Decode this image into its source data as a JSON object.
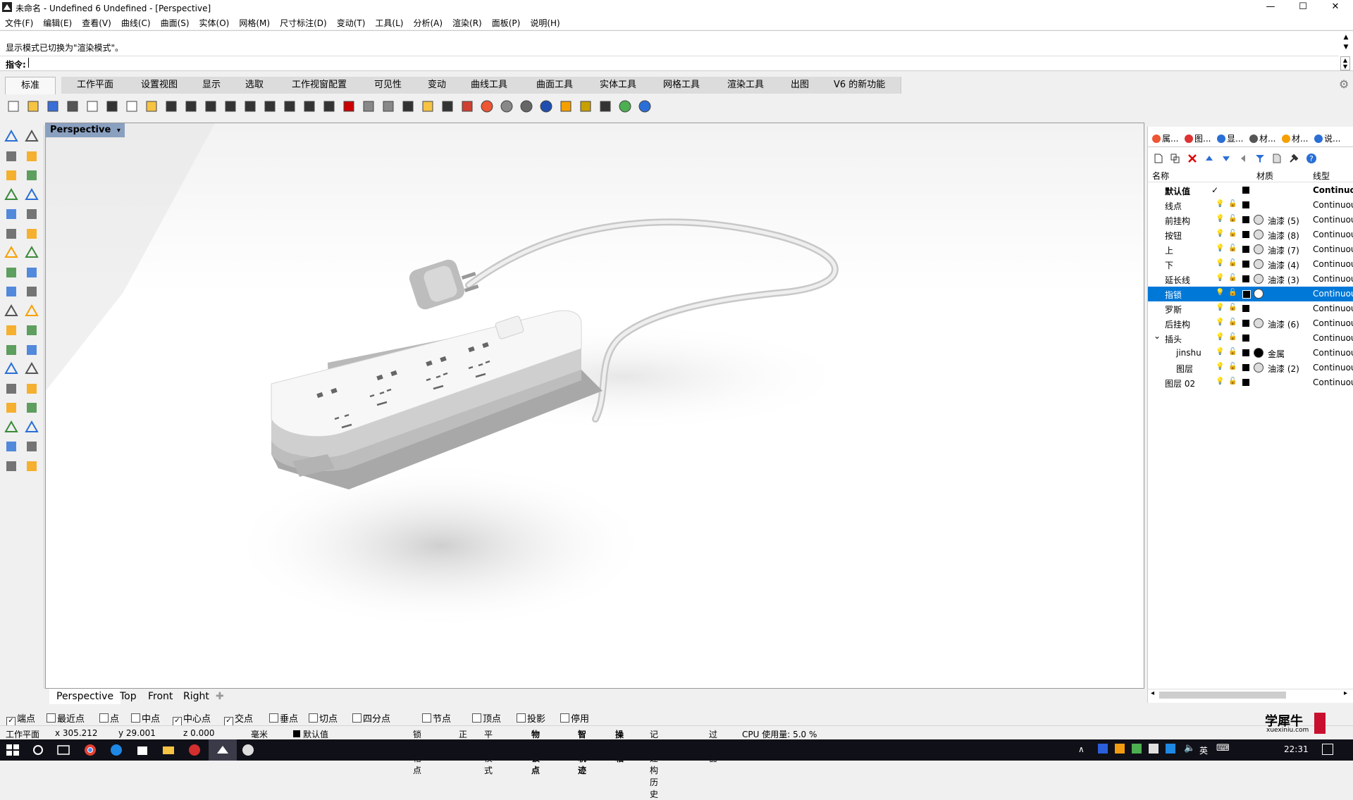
{
  "titlebar": {
    "title": "未命名 - Undefined 6 Undefined - [Perspective]",
    "minimize": "—",
    "maximize": "☐",
    "close": "✕"
  },
  "menu": [
    "文件(F)",
    "编辑(E)",
    "查看(V)",
    "曲线(C)",
    "曲面(S)",
    "实体(O)",
    "网格(M)",
    "尺寸标注(D)",
    "变动(T)",
    "工具(L)",
    "分析(A)",
    "渲染(R)",
    "面板(P)",
    "说明(H)"
  ],
  "command": {
    "history": "显示模式已切换为\"渲染模式\"。",
    "prompt": "指令:",
    "value": ""
  },
  "tabs": [
    "标准",
    "工作平面",
    "设置视图",
    "显示",
    "选取",
    "工作视窗配置",
    "可见性",
    "变动",
    "曲线工具",
    "曲面工具",
    "实体工具",
    "网格工具",
    "渲染工具",
    "出图",
    "V6 的新功能"
  ],
  "viewport": {
    "label": "Perspective"
  },
  "viewport_tabs": [
    "Perspective",
    "Top",
    "Front",
    "Right"
  ],
  "snaps": [
    {
      "label": "端点",
      "checked": true
    },
    {
      "label": "最近点",
      "checked": false
    },
    {
      "label": "点",
      "checked": false
    },
    {
      "label": "中点",
      "checked": false
    },
    {
      "label": "中心点",
      "checked": true
    },
    {
      "label": "交点",
      "checked": true
    },
    {
      "label": "垂点",
      "checked": false
    },
    {
      "label": "切点",
      "checked": false
    },
    {
      "label": "四分点",
      "checked": false
    },
    {
      "label": "节点",
      "checked": false
    },
    {
      "label": "顶点",
      "checked": false
    },
    {
      "label": "投影",
      "checked": false
    },
    {
      "label": "停用",
      "checked": false
    }
  ],
  "status": {
    "cplane": "工作平面",
    "x": "x 305.212",
    "y": "y 29.001",
    "z": "z 0.000",
    "unit": "毫米",
    "layer": "默认值",
    "items": [
      "锁定格点",
      "正交",
      "平面模式",
      "物件锁点",
      "智慧轨迹",
      "操作轴",
      "记录建构历史",
      "过滤器"
    ],
    "cpu": "CPU 使用量: 5.0 %"
  },
  "panel": {
    "tabs": [
      "属...",
      "图...",
      "显...",
      "材...",
      "材...",
      "说..."
    ],
    "headers": {
      "name": "名称",
      "material": "材质",
      "linetype": "线型"
    },
    "layers": [
      {
        "name": "默认值",
        "bold": true,
        "material": "",
        "linetype": "Continuous",
        "check": "✓"
      },
      {
        "name": "线点",
        "material": "",
        "linetype": "Continuous"
      },
      {
        "name": "前挂构",
        "material": "油漆 (5)",
        "linetype": "Continuous"
      },
      {
        "name": "按钮",
        "material": "油漆 (8)",
        "linetype": "Continuous"
      },
      {
        "name": "上",
        "material": "油漆 (7)",
        "linetype": "Continuous"
      },
      {
        "name": "下",
        "material": "油漆 (4)",
        "linetype": "Continuous"
      },
      {
        "name": "延长线",
        "material": "油漆 (3)",
        "linetype": "Continuous"
      },
      {
        "name": "指锁",
        "material": "",
        "linetype": "Continuous",
        "selected": true
      },
      {
        "name": "罗斯",
        "material": "",
        "linetype": "Continuous"
      },
      {
        "name": "后挂构",
        "material": "油漆 (6)",
        "linetype": "Continuous"
      },
      {
        "name": "插头",
        "material": "",
        "linetype": "Continuous",
        "expander": "v"
      },
      {
        "name": "jinshu",
        "material": "金属",
        "linetype": "Continuous",
        "indent": true
      },
      {
        "name": "图层",
        "material": "油漆 (2)",
        "linetype": "Continuous",
        "indent": true
      },
      {
        "name": "图层 02",
        "material": "",
        "linetype": "Continuous"
      }
    ]
  },
  "watermark": {
    "name": "学犀牛",
    "url": "xuexiniu.com"
  },
  "taskbar": {
    "time": "22:31",
    "lang": "英"
  }
}
